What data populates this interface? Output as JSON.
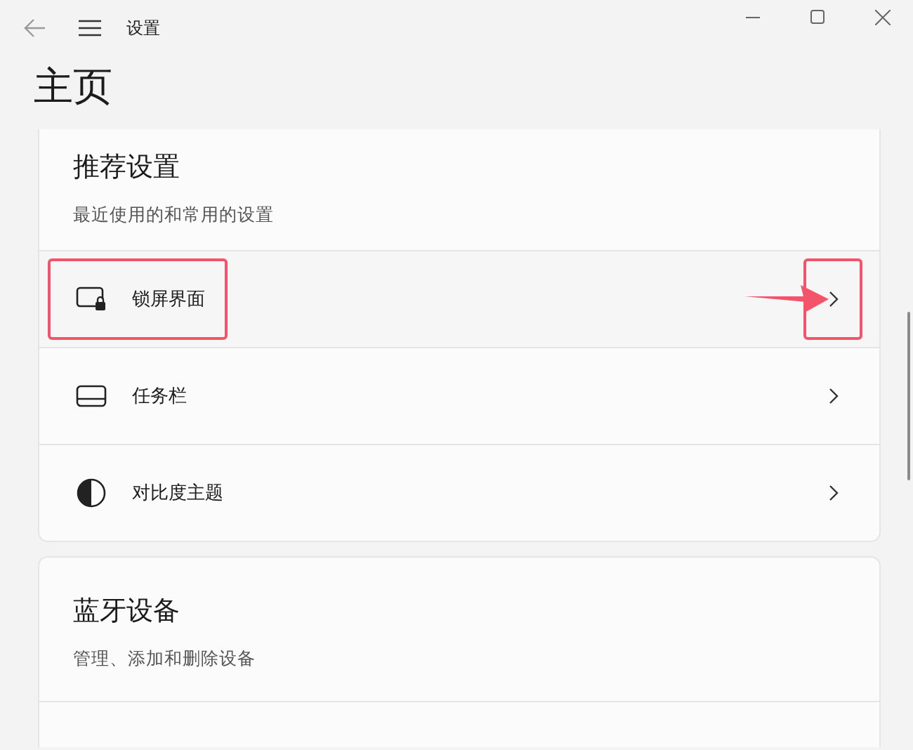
{
  "window": {
    "title": "设置"
  },
  "page_title": "主页",
  "cards": [
    {
      "title": "推荐设置",
      "subtitle": "最近使用的和常用的设置",
      "rows": [
        {
          "kind": "lock-screen",
          "label": "锁屏界面",
          "highlighted": true
        },
        {
          "kind": "taskbar",
          "label": "任务栏",
          "highlighted": false
        },
        {
          "kind": "contrast",
          "label": "对比度主题",
          "highlighted": false
        }
      ]
    },
    {
      "title": "蓝牙设备",
      "subtitle": "管理、添加和删除设备"
    }
  ]
}
